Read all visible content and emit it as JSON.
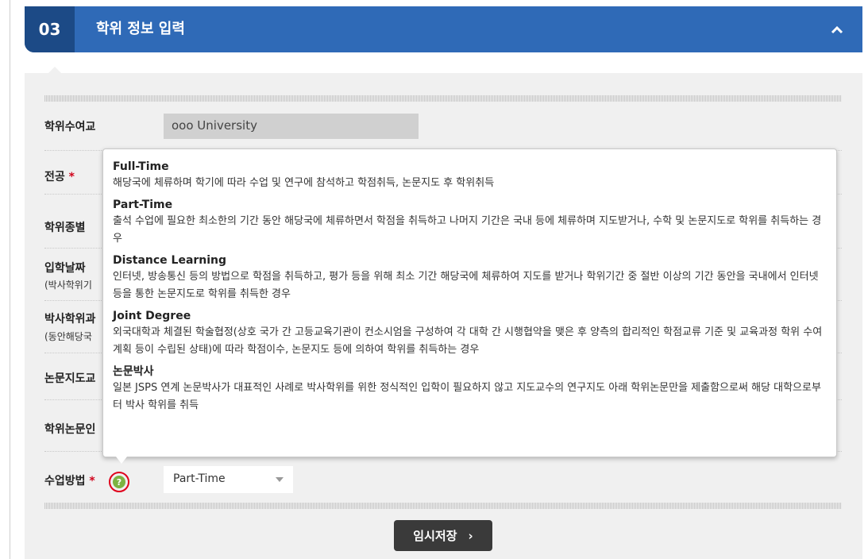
{
  "section": {
    "number": "03",
    "title": "학위 정보 입력"
  },
  "form": {
    "university_label": "학위수여교",
    "university_value": "ooo University",
    "major_label": "전공",
    "degree_type_label": "학위종별",
    "admission_date_label": "입학날짜",
    "admission_date_sub": "(박사학위기",
    "doctorate_label": "박사학위과",
    "doctorate_sub": "(동안해당국",
    "thesis_advisor_label": "논문지도교",
    "thesis_label": "학위논문인",
    "class_method_label": "수업방법",
    "class_method_value": "Part-Time",
    "required_mark": "*"
  },
  "tooltip": {
    "items": [
      {
        "title": "Full-Time",
        "desc": "해당국에 체류하며 학기에 따라 수업 및 연구에 참석하고 학점취득, 논문지도 후 학위취득"
      },
      {
        "title": "Part-Time",
        "desc": "출석 수업에 필요한 최소한의 기간 동안 해당국에 체류하면서 학점을 취득하고 나머지 기간은 국내 등에 체류하며 지도받거나, 수학 및 논문지도로 학위를 취득하는 경우"
      },
      {
        "title": "Distance Learning",
        "desc": "인터넷, 방송통신 등의 방법으로 학점을 취득하고, 평가 등을 위해 최소 기간 해당국에 체류하여 지도를 받거나 학위기간 중 절반 이상의 기간 동안을 국내에서 인터넷 등을 통한 논문지도로 학위를 취득한 경우"
      },
      {
        "title": "Joint Degree",
        "desc": "외국대학과 체결된 학술협정(상호 국가 간 고등교육기관이 컨소시엄을 구성하여 각 대학 간 시행협약을 맺은 후 양측의 합리적인 학점교류 기준 및 교육과정 학위 수여계획 등이 수립된 상태)에 따라 학점이수, 논문지도 등에 의하여 학위를 취득하는 경우"
      },
      {
        "title": "논문박사",
        "desc": "일본 JSPS 연계 논문박사가 대표적인 사례로 박사학위를 위한 정식적인 입학이 필요하지 않고 지도교수의 연구지도 아래 학위논문만을 제출함으로써 해당 대학으로부터 박사 학위를 취득"
      }
    ]
  },
  "buttons": {
    "save_label": "임시저장",
    "save_arrow": "›",
    "help_glyph": "?"
  },
  "colors": {
    "header": "#2f6ab7",
    "step_box": "#1c4a86",
    "help_ring": "#e0001b",
    "help_fill": "#7cb342"
  }
}
